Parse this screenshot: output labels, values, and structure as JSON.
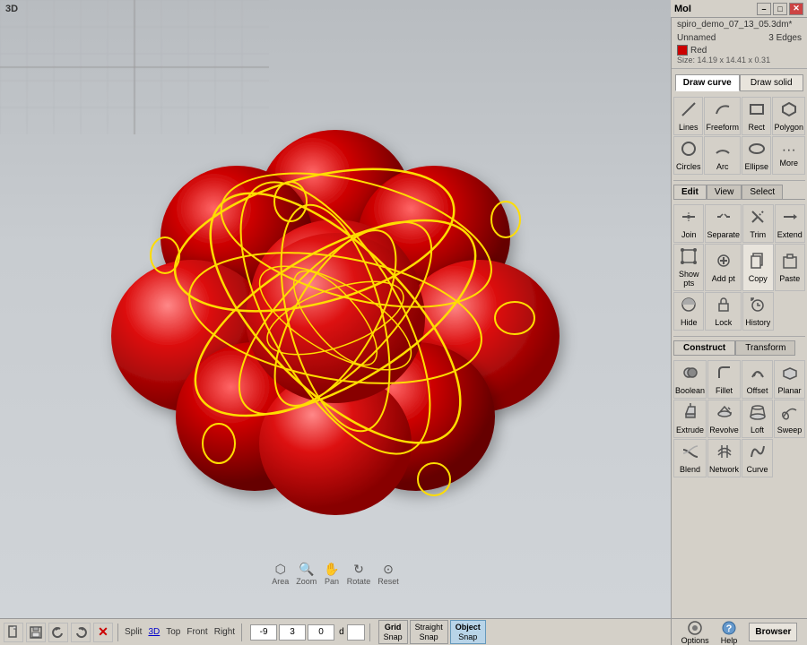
{
  "titlebar": {
    "title": "MoI",
    "min": "–",
    "max": "□",
    "close": "✕"
  },
  "file": {
    "filename": "spiro_demo_07_13_05.3dm*"
  },
  "object": {
    "name": "Unnamed",
    "edges": "3 Edges",
    "color_label": "Red",
    "size": "Size: 14.19 x 14.41 x 0.31"
  },
  "draw_curve_tab": "Draw curve",
  "draw_solid_tab": "Draw solid",
  "draw_curve_tools": [
    {
      "id": "lines",
      "label": "Lines",
      "icon": "/"
    },
    {
      "id": "freeform",
      "label": "Freeform",
      "icon": "∿"
    },
    {
      "id": "rect",
      "label": "Rect",
      "icon": "□"
    },
    {
      "id": "polygon",
      "label": "Polygon",
      "icon": "⬡"
    },
    {
      "id": "circles",
      "label": "Circles",
      "icon": "○"
    },
    {
      "id": "arc",
      "label": "Arc",
      "icon": "⌒"
    },
    {
      "id": "ellipse",
      "label": "Ellipse",
      "icon": "⬭"
    },
    {
      "id": "more",
      "label": "More",
      "icon": "···"
    }
  ],
  "edit_tab": "Edit",
  "view_tab": "View",
  "select_tab": "Select",
  "edit_tools": [
    {
      "id": "join",
      "label": "Join",
      "icon": "⇔"
    },
    {
      "id": "separate",
      "label": "Separate",
      "icon": "⇄"
    },
    {
      "id": "trim",
      "label": "Trim",
      "icon": "✂"
    },
    {
      "id": "extend",
      "label": "Extend",
      "icon": "→"
    },
    {
      "id": "show-pts",
      "label": "Show pts",
      "icon": "⊡"
    },
    {
      "id": "add-pt",
      "label": "Add pt",
      "icon": "⊕"
    },
    {
      "id": "copy",
      "label": "Copy",
      "icon": "⎘"
    },
    {
      "id": "paste",
      "label": "Paste",
      "icon": "📋"
    },
    {
      "id": "hide",
      "label": "Hide",
      "icon": "◑"
    },
    {
      "id": "lock",
      "label": "Lock",
      "icon": "🔒"
    },
    {
      "id": "history",
      "label": "History",
      "icon": "↺"
    }
  ],
  "construct_tab": "Construct",
  "transform_tab": "Transform",
  "construct_tools": [
    {
      "id": "boolean",
      "label": "Boolean",
      "icon": "⊕"
    },
    {
      "id": "fillet",
      "label": "Fillet",
      "icon": "⌣"
    },
    {
      "id": "offset",
      "label": "Offset",
      "icon": "⟳"
    },
    {
      "id": "planar",
      "label": "Planar",
      "icon": "▱"
    },
    {
      "id": "extrude",
      "label": "Extrude",
      "icon": "⬆"
    },
    {
      "id": "revolve",
      "label": "Revolve",
      "icon": "↻"
    },
    {
      "id": "loft",
      "label": "Loft",
      "icon": "⬗"
    },
    {
      "id": "sweep",
      "label": "Sweep",
      "icon": "⌀"
    },
    {
      "id": "blend",
      "label": "Blend",
      "icon": "〰"
    },
    {
      "id": "network",
      "label": "Network",
      "icon": "⊞"
    },
    {
      "id": "curve",
      "label": "Curve",
      "icon": "⌓"
    }
  ],
  "viewport_label": "3D",
  "nav_items": [
    {
      "id": "area",
      "label": "Area"
    },
    {
      "id": "zoom",
      "label": "Zoom"
    },
    {
      "id": "pan",
      "label": "Pan"
    },
    {
      "id": "rotate",
      "label": "Rotate"
    },
    {
      "id": "reset",
      "label": "Reset"
    }
  ],
  "toolbar": {
    "file": "File",
    "save": "Save",
    "undo": "Undo",
    "redo": "Redo",
    "delete": "Delete",
    "split": "Split",
    "view_3d": "3D",
    "view_top": "Top",
    "view_front": "Front",
    "view_right": "Right"
  },
  "coords": {
    "x": "-9",
    "y": "3",
    "z": "0",
    "label": "d"
  },
  "snap": {
    "grid": "Grid\nSnap",
    "straight": "Straight\nSnap",
    "object": "Object\nSnap"
  },
  "right_bottom": {
    "options": "Options",
    "help": "Help",
    "browser": "Browser"
  }
}
